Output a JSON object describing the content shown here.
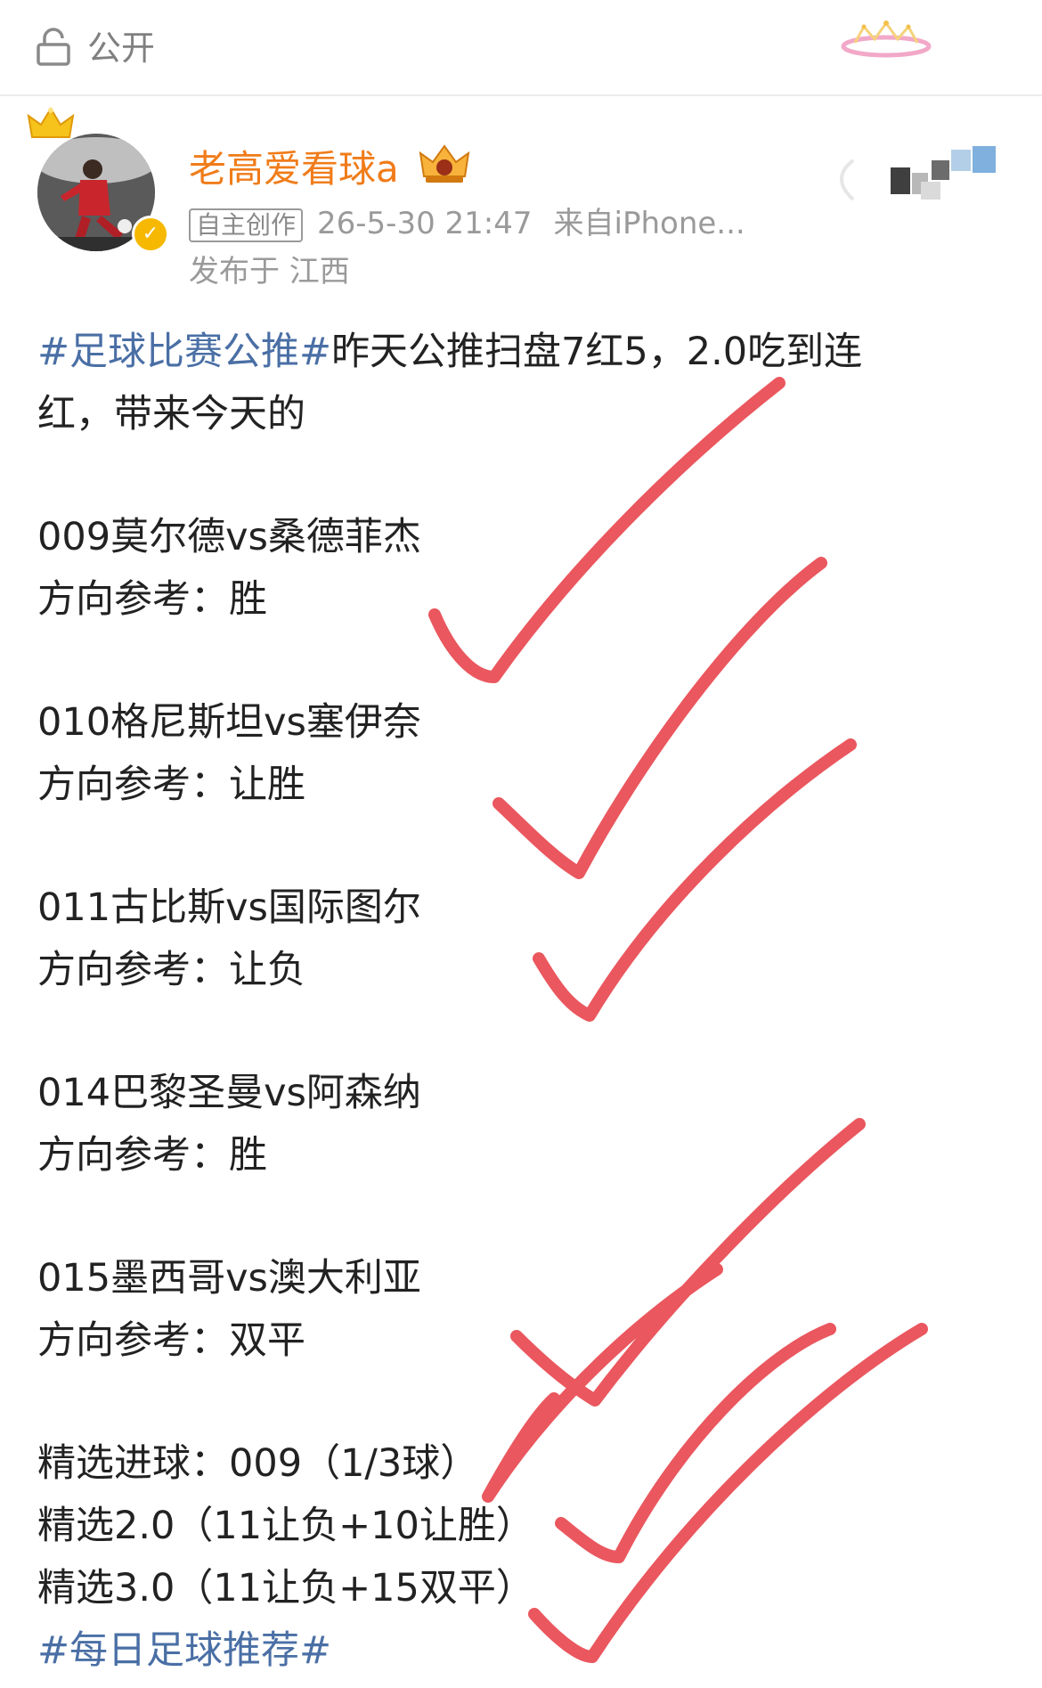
{
  "header": {
    "visibility_label": "公开",
    "lock_icon": "lock-icon",
    "decoration_icon": "tiara-sparkle-icon"
  },
  "author": {
    "name": "老高爱看球a",
    "verified_icon": "verified-check-icon",
    "vip_icon": "vip-crown-icon",
    "tag": "自主创作",
    "time": "26-5-30 21:47",
    "source": "来自iPhone...",
    "location": "发布于 江西"
  },
  "post": {
    "intro_hashtag": "#足球比赛公推#",
    "intro_text_1": "昨天公推扫盘7红5，2.0吃到连",
    "intro_text_2": "红，带来今天的",
    "matches": [
      {
        "title": "009莫尔德vs桑德菲杰",
        "pick": "方向参考：胜"
      },
      {
        "title": "010格尼斯坦vs塞伊奈",
        "pick": "方向参考：让胜"
      },
      {
        "title": "011古比斯vs国际图尔",
        "pick": "方向参考：让负"
      },
      {
        "title": "014巴黎圣曼vs阿森纳",
        "pick": "方向参考：胜"
      },
      {
        "title": "015墨西哥vs澳大利亚",
        "pick": "方向参考：双平"
      }
    ],
    "selections": [
      "精选进球：009（1/3球）",
      "精选2.0（11让负+10让胜）",
      "精选3.0（11让负+15双平）"
    ],
    "footer_hashtag": "#每日足球推荐#"
  },
  "annotations": {
    "check_color": "#e8454d",
    "check_count": 7
  }
}
